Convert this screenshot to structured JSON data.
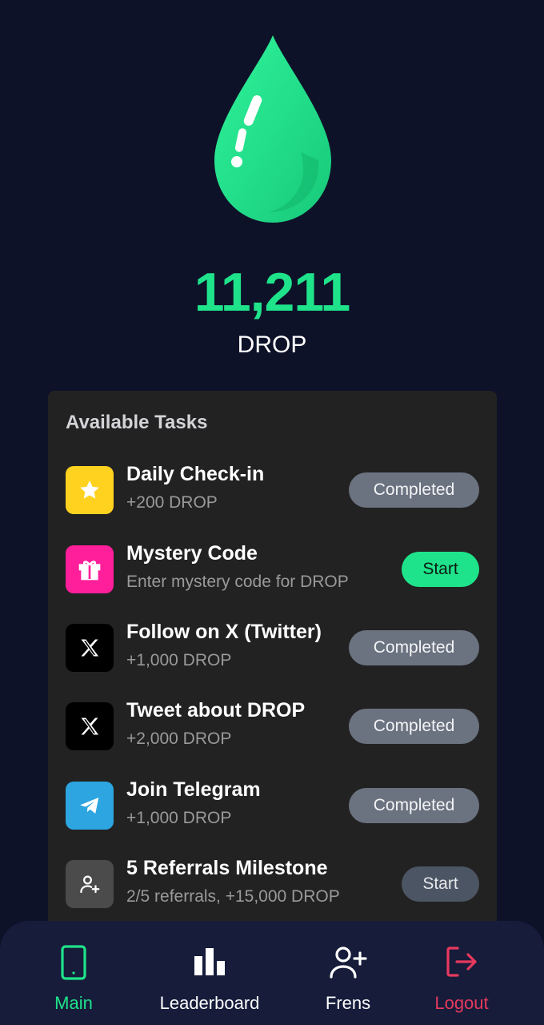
{
  "balance": {
    "amount": "11,211",
    "unit": "DROP"
  },
  "tasks": {
    "title": "Available Tasks",
    "items": [
      {
        "name": "Daily Check-in",
        "subtitle": "+200 DROP",
        "icon": "star-icon",
        "icon_bg": "#ffd21f",
        "button": "Completed",
        "state": "completed"
      },
      {
        "name": "Mystery Code",
        "subtitle": "Enter mystery code for DROP",
        "icon": "gift-icon",
        "icon_bg": "#ff1f9a",
        "button": "Start",
        "state": "start"
      },
      {
        "name": "Follow on X (Twitter)",
        "subtitle": "+1,000 DROP",
        "icon": "x-logo-icon",
        "icon_bg": "#000000",
        "button": "Completed",
        "state": "completed"
      },
      {
        "name": "Tweet about DROP",
        "subtitle": "+2,000 DROP",
        "icon": "x-logo-icon",
        "icon_bg": "#000000",
        "button": "Completed",
        "state": "completed"
      },
      {
        "name": "Join Telegram",
        "subtitle": "+1,000 DROP",
        "icon": "telegram-icon",
        "icon_bg": "#2ca5e0",
        "button": "Completed",
        "state": "completed"
      },
      {
        "name": "5 Referrals Milestone",
        "subtitle": "2/5 referrals, +15,000 DROP",
        "icon": "add-user-icon",
        "icon_bg": "#4b4b4b",
        "button": "Start",
        "state": "start-disabled"
      }
    ]
  },
  "nav": {
    "main": "Main",
    "leaderboard": "Leaderboard",
    "frens": "Frens",
    "logout": "Logout"
  },
  "colors": {
    "accent": "#1fe38a",
    "logout": "#e8395e",
    "background": "#0d1229",
    "card": "#222222"
  }
}
